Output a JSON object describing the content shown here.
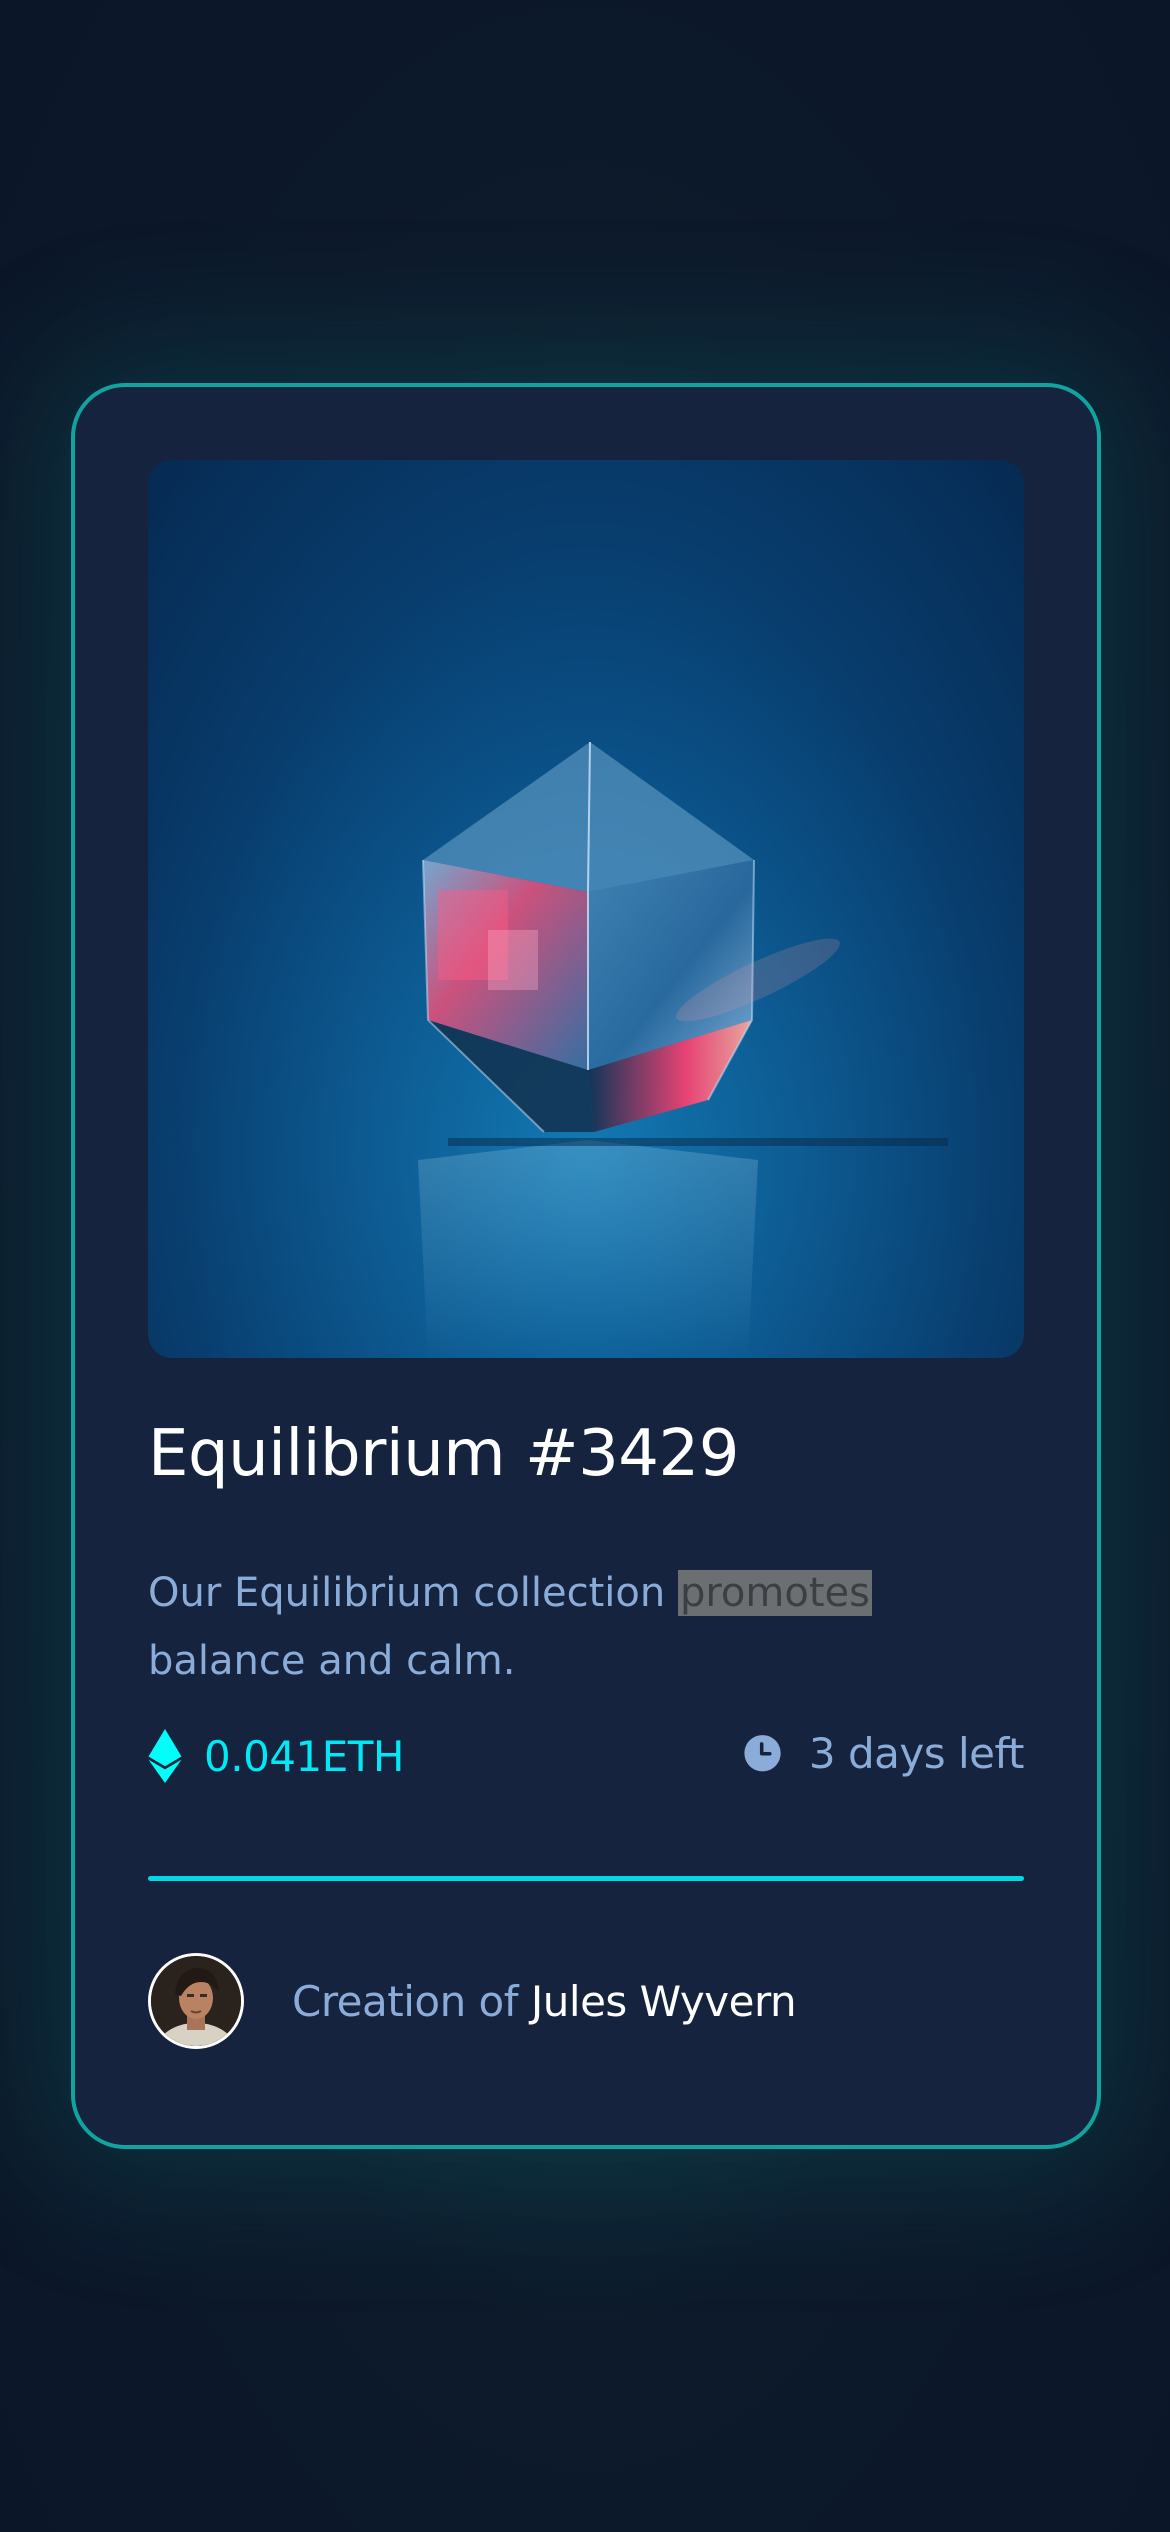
{
  "card": {
    "image_alt": "Equilibrium glass cube",
    "title": "Equilibrium #3429",
    "description_before": "Our Equilibrium collection ",
    "description_highlight": "promotes",
    "description_after": " balance and calm.",
    "price": "0.041ETH",
    "time_left": "3 days left",
    "creator_prefix": "Creation of ",
    "creator_name": "Jules Wyvern"
  },
  "colors": {
    "accent_cyan": "#00e9f5",
    "border_teal": "#11a39d",
    "card_bg": "#15233e",
    "muted_text": "#8bacd9"
  },
  "icons": {
    "price": "ethereum-icon",
    "time": "clock-icon"
  }
}
